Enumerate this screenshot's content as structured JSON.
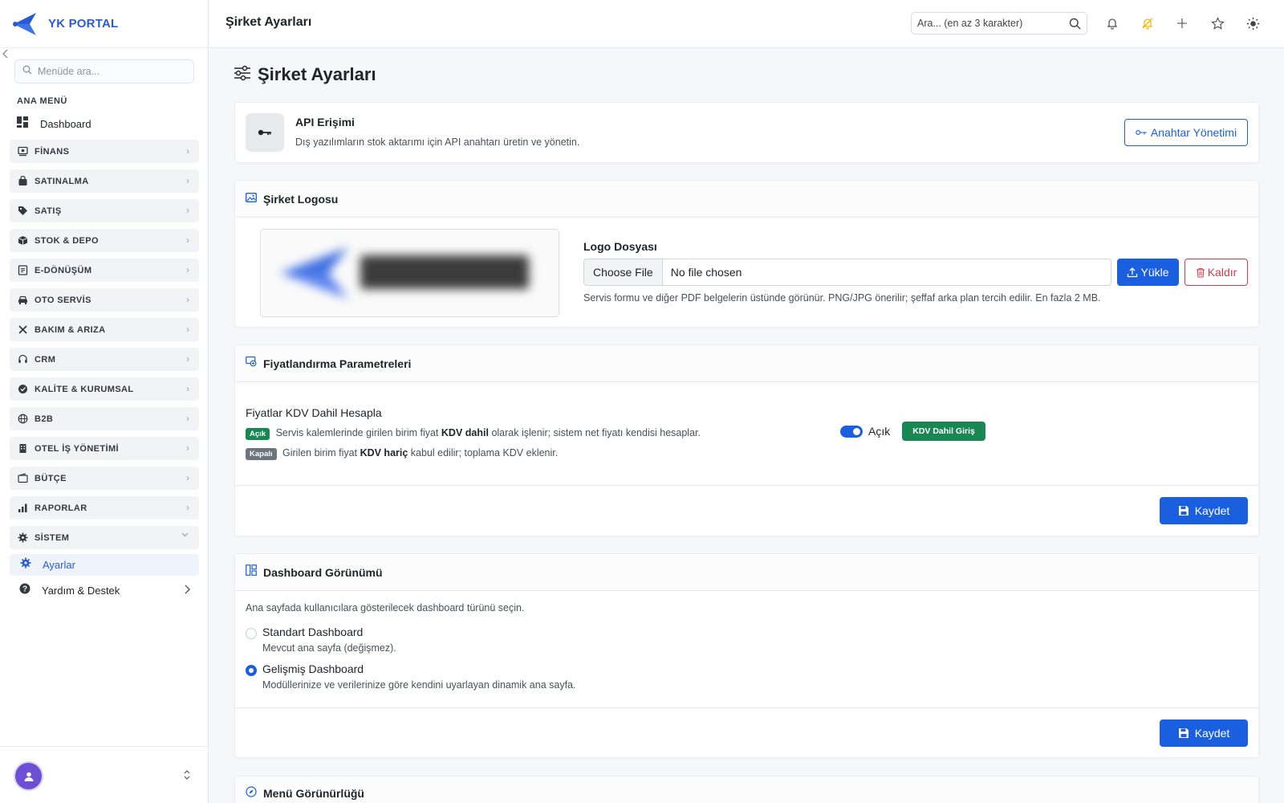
{
  "brand": {
    "name": "YK PORTAL"
  },
  "sidebar": {
    "search_placeholder": "Menüde ara...",
    "section_title": "ANA MENÜ",
    "dashboard_label": "Dashboard",
    "groups": [
      {
        "label": "FİNANS",
        "icon": "finance-icon"
      },
      {
        "label": "SATINALMA",
        "icon": "bag-icon"
      },
      {
        "label": "SATIŞ",
        "icon": "tag-icon"
      },
      {
        "label": "STOK & DEPO",
        "icon": "box-icon"
      },
      {
        "label": "E-DÖNÜŞÜM",
        "icon": "document-icon"
      },
      {
        "label": "OTO SERVİS",
        "icon": "car-icon"
      },
      {
        "label": "BAKIM & ARIZA",
        "icon": "tools-icon"
      },
      {
        "label": "CRM",
        "icon": "headset-icon"
      },
      {
        "label": "KALİTE & KURUMSAL",
        "icon": "badge-check-icon"
      },
      {
        "label": "B2B",
        "icon": "globe-icon"
      },
      {
        "label": "OTEL İŞ YÖNETİMİ",
        "icon": "building-icon"
      },
      {
        "label": "BÜTÇE",
        "icon": "wallet-icon"
      },
      {
        "label": "RAPORLAR",
        "icon": "bar-chart-icon"
      },
      {
        "label": "SİSTEM",
        "icon": "gear-icon"
      }
    ],
    "active_sub_item": "Ayarlar",
    "help_label": "Yardım & Destek"
  },
  "topbar": {
    "title": "Şirket Ayarları",
    "search_placeholder": "Ara... (en az 3 karakter)"
  },
  "page": {
    "heading": "Şirket Ayarları"
  },
  "api_card": {
    "title": "API Erişimi",
    "description": "Dış yazılımların stok aktarımı için API anahtarı üretin ve yönetin.",
    "button": "Anahtar Yönetimi"
  },
  "logo_card": {
    "title": "Şirket Logosu",
    "field_label": "Logo Dosyası",
    "choose_file": "Choose File",
    "no_file": "No file chosen",
    "upload_button": "Yükle",
    "remove_button": "Kaldır",
    "help": "Servis formu ve diğer PDF belgelerin üstünde görünür. PNG/JPG önerilir; şeffaf arka plan tercih edilir. En fazla 2 MB."
  },
  "pricing_card": {
    "title": "Fiyatlandırma Parametreleri",
    "setting_title": "Fiyatlar KDV Dahil Hesapla",
    "on_badge": "Açık",
    "on_text_1": "Servis kalemlerinde girilen birim fiyat",
    "on_text_bold": "KDV dahil",
    "on_text_2": "olarak işlenir; sistem net fiyatı kendisi hesaplar.",
    "off_badge": "Kapalı",
    "off_text_1": "Girilen birim fiyat",
    "off_text_bold": "KDV hariç",
    "off_text_2": "kabul edilir; toplama KDV eklenir.",
    "toggle_state": "Açık",
    "toggle_on": true,
    "state_badge": "KDV Dahil Giriş",
    "save_button": "Kaydet"
  },
  "dashboard_card": {
    "title": "Dashboard Görünümü",
    "description": "Ana sayfada kullanıcılara gösterilecek dashboard türünü seçin.",
    "options": [
      {
        "label": "Standart Dashboard",
        "hint": "Mevcut ana sayfa (değişmez).",
        "checked": false
      },
      {
        "label": "Gelişmiş Dashboard",
        "hint": "Modüllerinize ve verilerinize göre kendini uyarlayan dinamik ana sayfa.",
        "checked": true
      }
    ],
    "save_button": "Kaydet"
  },
  "menu_card": {
    "title": "Menü Görünürlüğü"
  },
  "colors": {
    "primary": "#1a5fe0",
    "success": "#198754",
    "danger": "#d63a47",
    "secondary": "#6c757d",
    "bell_warning": "#f0b90b"
  }
}
